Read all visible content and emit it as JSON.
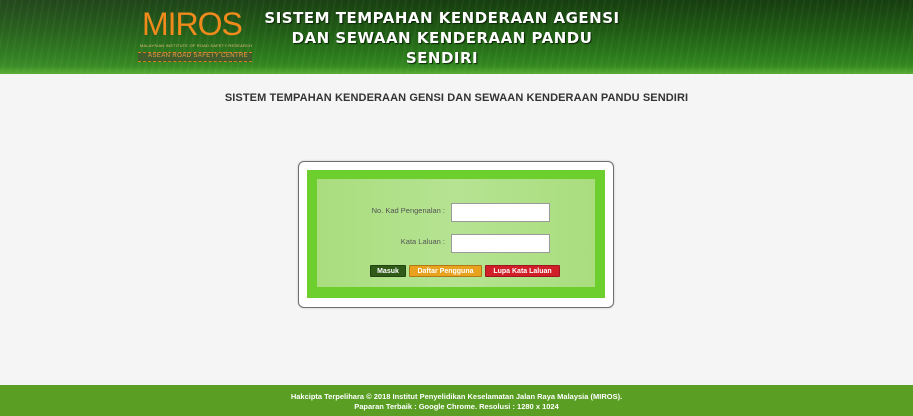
{
  "header": {
    "logo": {
      "name": "MIROS",
      "subtitle": "MALAYSIAN INSTITUTE OF ROAD SAFETY RESEARCH",
      "tagline": "ASEAN ROAD SAFETY CENTRE"
    },
    "title_lines": [
      "SISTEM TEMPAHAN KENDERAAN AGENSI",
      "DAN SEWAAN KENDERAAN PANDU",
      "SENDIRI"
    ]
  },
  "page": {
    "subtitle": "SISTEM TEMPAHAN KENDERAAN GENSI DAN SEWAAN KENDERAAN PANDU SENDIRI"
  },
  "login": {
    "ic_label": "No. Kad Pengenalan :",
    "ic_value": "",
    "password_label": "Kata Laluan :",
    "password_value": "",
    "buttons": {
      "login": "Masuk",
      "register": "Daftar Pengguna",
      "forgot": "Lupa Kata Laluan"
    }
  },
  "footer": {
    "line1": "Hakcipta Terpelihara © 2018 Institut Penyelidikan Keselamatan Jalan Raya Malaysia (MIROS).",
    "line2": "Paparan Terbaik : Google Chrome. Resolusi : 1280 x 1024"
  },
  "colors": {
    "logo_orange": "#f08a1c",
    "login_green": "#6ccf2e",
    "footer_green": "#5a9f23",
    "button_login": "#2f5a17",
    "button_register": "#e8a21e",
    "button_forgot": "#d11f2a"
  }
}
